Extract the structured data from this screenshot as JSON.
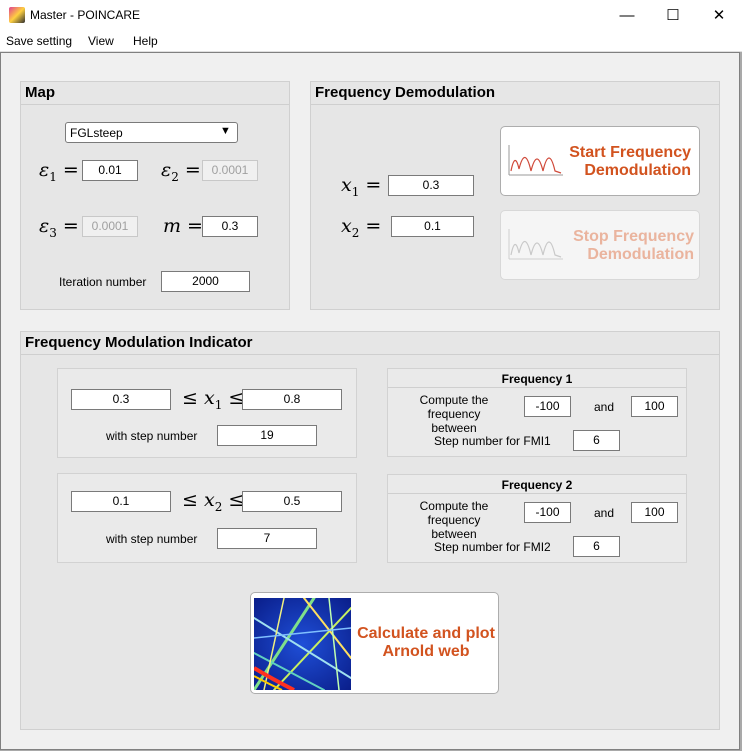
{
  "window": {
    "title": "Master - POINCARE"
  },
  "menu": [
    "Save setting",
    "View",
    "Help"
  ],
  "map": {
    "title": "Map",
    "map_selected": "FGLsteep",
    "eps1_value": "0.01",
    "eps2_value": "0.0001",
    "eps3_value": "0.0001",
    "m_value": "0.3",
    "iteration_label": "Iteration number",
    "iteration_value": "2000"
  },
  "demod": {
    "title": "Frequency Demodulation",
    "x1_value": "0.3",
    "x2_value": "0.1",
    "start_label_1": "Start Frequency",
    "start_label_2": "Demodulation",
    "stop_label_1": "Stop Frequency",
    "stop_label_2": "Demodulation"
  },
  "fmi": {
    "title": "Frequency Modulation Indicator",
    "x1_min": "0.3",
    "x1_max": "0.8",
    "x1_steps": "19",
    "x2_min": "0.1",
    "x2_max": "0.5",
    "x2_steps": "7",
    "step_label": "with step number",
    "f1": {
      "title": "Frequency 1",
      "compute_label_1": "Compute the",
      "compute_label_2": "frequency between",
      "min": "-100",
      "and": "and",
      "max": "100",
      "step_label": "Step number for FMI1",
      "steps": "6"
    },
    "f2": {
      "title": "Frequency 2",
      "compute_label_1": "Compute the",
      "compute_label_2": "frequency between",
      "min": "-100",
      "and": "and",
      "max": "100",
      "step_label": "Step number for FMI2",
      "steps": "6"
    },
    "calc_label_1": "Calculate and plot",
    "calc_label_2": "Arnold web"
  }
}
